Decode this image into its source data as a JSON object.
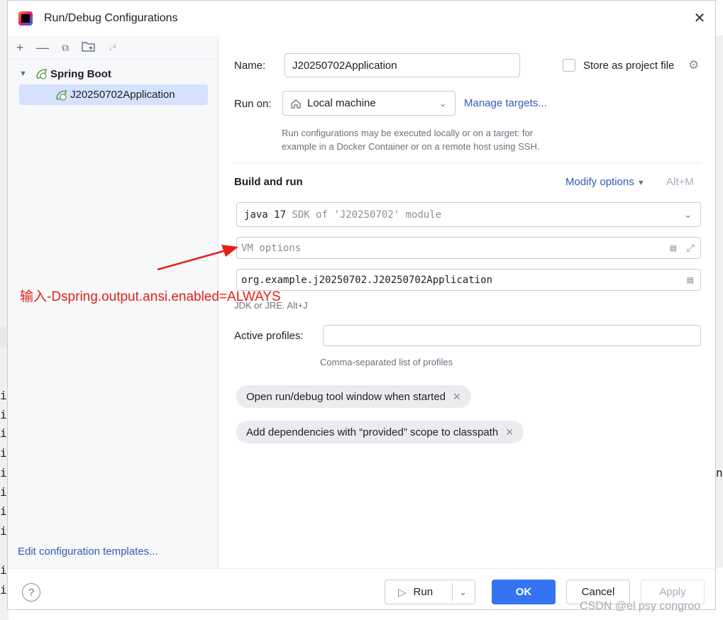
{
  "window": {
    "title": "Run/Debug Configurations"
  },
  "tree": {
    "root_label": "Spring Boot",
    "selected_label": "J20250702Application"
  },
  "left_footer": {
    "edit_templates": "Edit configuration templates..."
  },
  "form": {
    "name_label": "Name:",
    "name_value": "J20250702Application",
    "store_label": "Store as project file",
    "run_on_label": "Run on:",
    "run_on_value": "Local machine",
    "manage_targets": "Manage targets...",
    "run_on_hint_1": "Run configurations may be executed locally or on a target: for",
    "run_on_hint_2": "example in a Docker Container or on a remote host using SSH.",
    "section_title": "Build and run",
    "modify_options": "Modify options",
    "modify_shortcut": "Alt+M",
    "jdk_main": "java 17",
    "jdk_detail": "SDK of 'J20250702' module",
    "vm_placeholder": "VM options",
    "main_class": "org.example.j20250702.J20250702Application",
    "jdk_hint": "JDK or JRE. Alt+J",
    "profiles_label": "Active profiles:",
    "profiles_value": "",
    "profiles_hint": "Comma-separated list of profiles",
    "chip_1": "Open run/debug tool window when started",
    "chip_2": "Add dependencies with “provided” scope to classpath"
  },
  "footer": {
    "help": "?",
    "run": "Run",
    "ok": "OK",
    "cancel": "Cancel",
    "apply": "Apply"
  },
  "annotation": {
    "text": "输入-Dspring.output.ansi.enabled=ALWAYS"
  },
  "watermark": "CSDN @el psy congroo",
  "background_code": {
    "line_fragment": "i",
    "right_fragment": "n"
  },
  "colors": {
    "accent": "#3574f0",
    "annotation": "#e32118",
    "link": "#2f5bb7",
    "selection": "#d5e1ff"
  }
}
